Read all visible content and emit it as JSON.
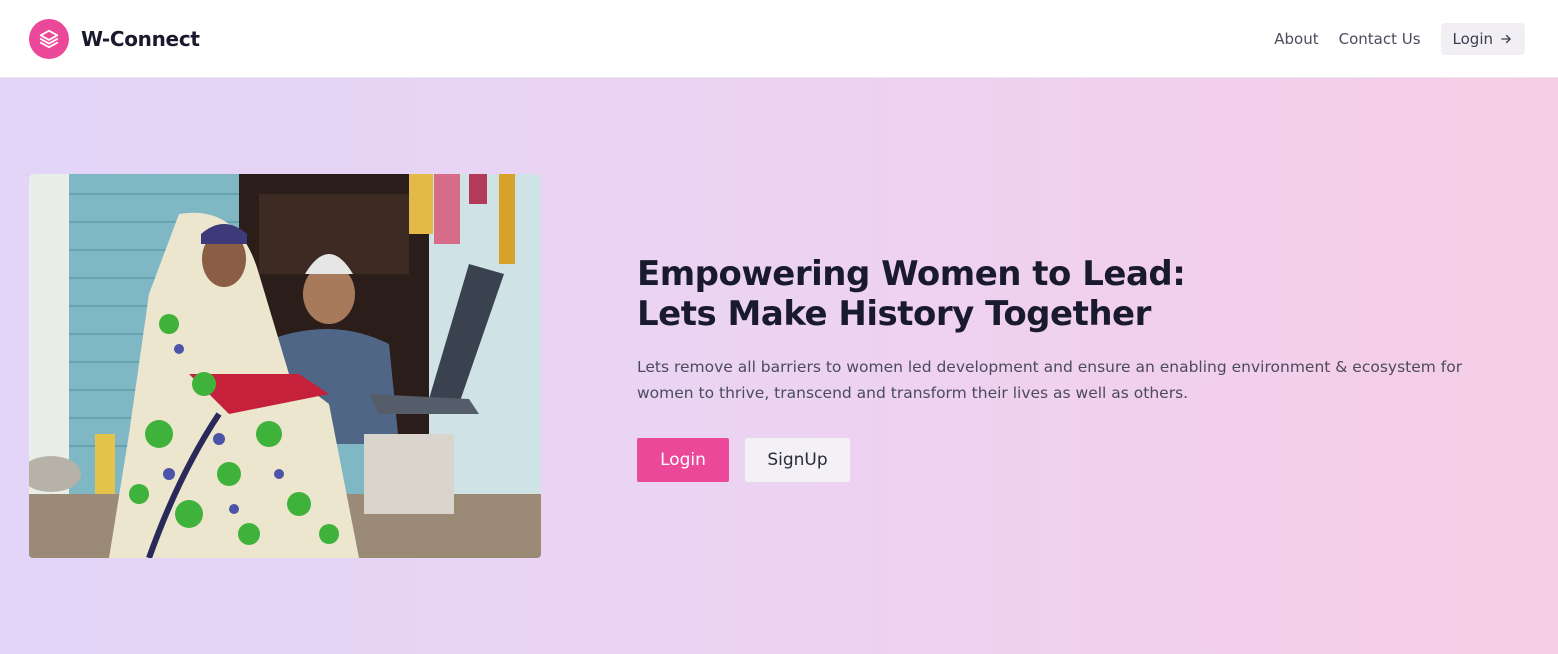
{
  "brand": {
    "name": "W-Connect",
    "logo_icon": "stacked-layers-icon",
    "logo_color": "#ec4899"
  },
  "nav": {
    "about": "About",
    "contact": "Contact Us",
    "login": "Login",
    "login_icon": "arrow-right-icon"
  },
  "hero": {
    "image_alt": "Woman and elderly man using a laptop in a village",
    "headline_line1": "Empowering Women to Lead:",
    "headline_line2": "Lets Make History Together",
    "description": "Lets remove all barriers to women led development and ensure an enabling environment & ecosystem for women to thrive, transcend and transform their lives as well as others.",
    "login_button": "Login",
    "signup_button": "SignUp"
  },
  "colors": {
    "accent": "#ec4899",
    "gradient_start": "#e2d5f8",
    "gradient_end": "#f6cde6"
  }
}
